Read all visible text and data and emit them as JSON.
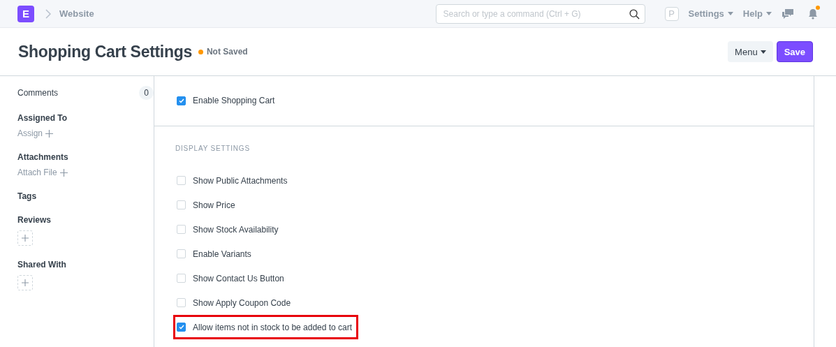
{
  "navbar": {
    "logo": "E",
    "breadcrumb": "Website",
    "search": {
      "placeholder": "Search or type a command (Ctrl + G)"
    },
    "avatar": "P",
    "menus": [
      "Settings",
      "Help"
    ],
    "notification_unread": true
  },
  "page": {
    "title": "Shopping Cart Settings",
    "status": "Not Saved",
    "buttons": [
      {
        "label": "Menu",
        "kind": "dropdown"
      },
      {
        "label": "Save",
        "kind": "primary"
      }
    ]
  },
  "sidebar": {
    "comments": {
      "label": "Comments",
      "count": "0"
    },
    "sections": [
      {
        "heading": "Assigned To",
        "kind": "link",
        "action": "Assign"
      },
      {
        "heading": "Attachments",
        "kind": "link",
        "action": "Attach File"
      },
      {
        "heading": "Tags",
        "kind": "none"
      },
      {
        "heading": "Reviews",
        "kind": "add"
      },
      {
        "heading": "Shared With",
        "kind": "add"
      }
    ]
  },
  "form": {
    "sections": [
      {
        "fields": [
          {
            "label": "Enable Shopping Cart",
            "checked": true,
            "highlighted": false
          }
        ]
      },
      {
        "heading": "DISPLAY SETTINGS",
        "fields": [
          {
            "label": "Show Public Attachments",
            "checked": false,
            "highlighted": false
          },
          {
            "label": "Show Price",
            "checked": false,
            "highlighted": false
          },
          {
            "label": "Show Stock Availability",
            "checked": false,
            "highlighted": false
          },
          {
            "label": "Enable Variants",
            "checked": false,
            "highlighted": false
          },
          {
            "label": "Show Contact Us Button",
            "checked": false,
            "highlighted": false
          },
          {
            "label": "Show Apply Coupon Code",
            "checked": false,
            "highlighted": false
          },
          {
            "label": "Allow items not in stock to be added to cart",
            "checked": true,
            "highlighted": true
          }
        ]
      }
    ]
  }
}
